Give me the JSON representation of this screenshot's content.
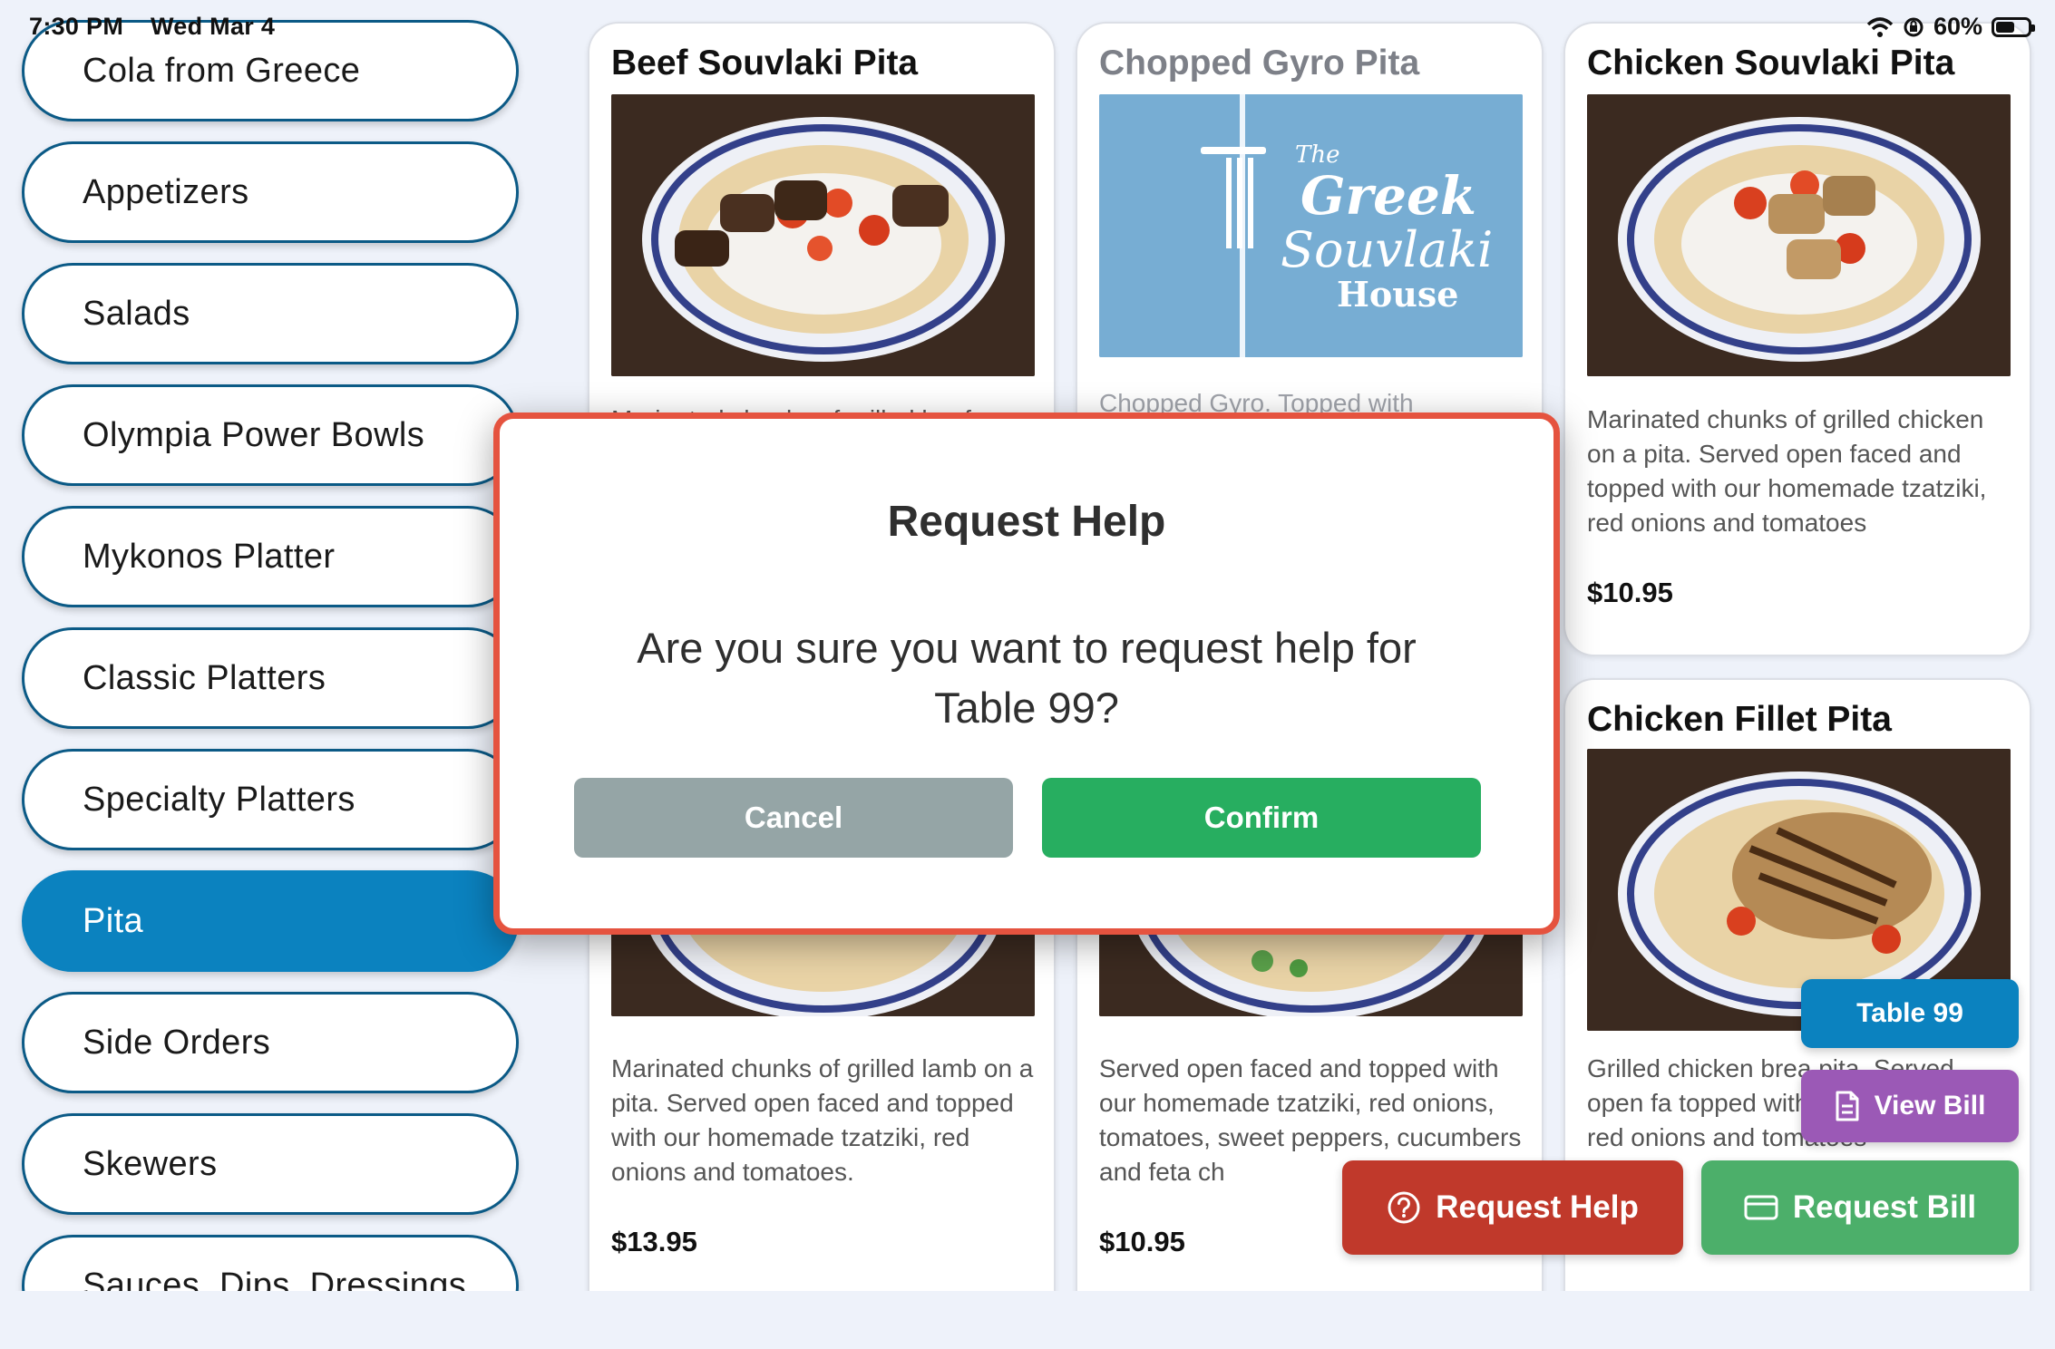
{
  "status_bar": {
    "time": "7:30 PM",
    "date": "Wed Mar 4",
    "battery": "60%",
    "battery_level": 0.6,
    "icons": [
      "wifi-icon",
      "orientation-lock-icon",
      "battery-icon"
    ]
  },
  "sidebar": {
    "items": [
      {
        "label": "Cola from Greece"
      },
      {
        "label": "Appetizers"
      },
      {
        "label": "Salads"
      },
      {
        "label": "Olympia Power Bowls"
      },
      {
        "label": "Mykonos Platter"
      },
      {
        "label": "Classic Platters"
      },
      {
        "label": "Specialty Platters"
      },
      {
        "label": "Pita",
        "active": true
      },
      {
        "label": "Side Orders"
      },
      {
        "label": "Skewers"
      },
      {
        "label": "Sauces, Dips, Dressings"
      }
    ]
  },
  "products": [
    {
      "title": "Beef Souvlaki Pita",
      "desc_visible": "Marinated chunks of grilled beef"
    },
    {
      "title": "Chopped Gyro Pita",
      "desc_visible": "Chopped Gyro. Topped with",
      "logo_text": [
        "The",
        "Greek",
        "Souvlaki",
        "House"
      ]
    },
    {
      "title": "Chicken Souvlaki Pita",
      "desc": "Marinated chunks of grilled chicken on a pita. Served open faced and topped with our homemade tzatziki, red onions and tomatoes",
      "price": "$10.95"
    },
    {
      "desc": "Marinated chunks of grilled lamb on a pita. Served open faced and topped with our homemade tzatziki, red onions and tomatoes.",
      "price": "$13.95"
    },
    {
      "desc": "Served open faced and topped with our homemade tzatziki, red onions, tomatoes, sweet peppers, cucumbers and feta ch",
      "price": "$10.95"
    },
    {
      "title": "Chicken Fillet Pita",
      "desc": "Grilled chicken brea pita. Served open fa topped with our homemade red onions and tomatoes"
    }
  ],
  "dialog": {
    "title": "Request Help",
    "message": "Are you sure you want to request help for Table 99?",
    "cancel_label": "Cancel",
    "confirm_label": "Confirm"
  },
  "floating": {
    "table_label": "Table 99",
    "view_bill_label": "View Bill",
    "request_help_label": "Request Help",
    "request_bill_label": "Request Bill"
  },
  "colors": {
    "accent_blue": "#0b82bf",
    "help_red": "#c0392b",
    "bill_purple": "#9b59b6",
    "confirm_green": "#27ae60",
    "cancel_gray": "#95a5a6",
    "dialog_border": "#e5533f"
  }
}
